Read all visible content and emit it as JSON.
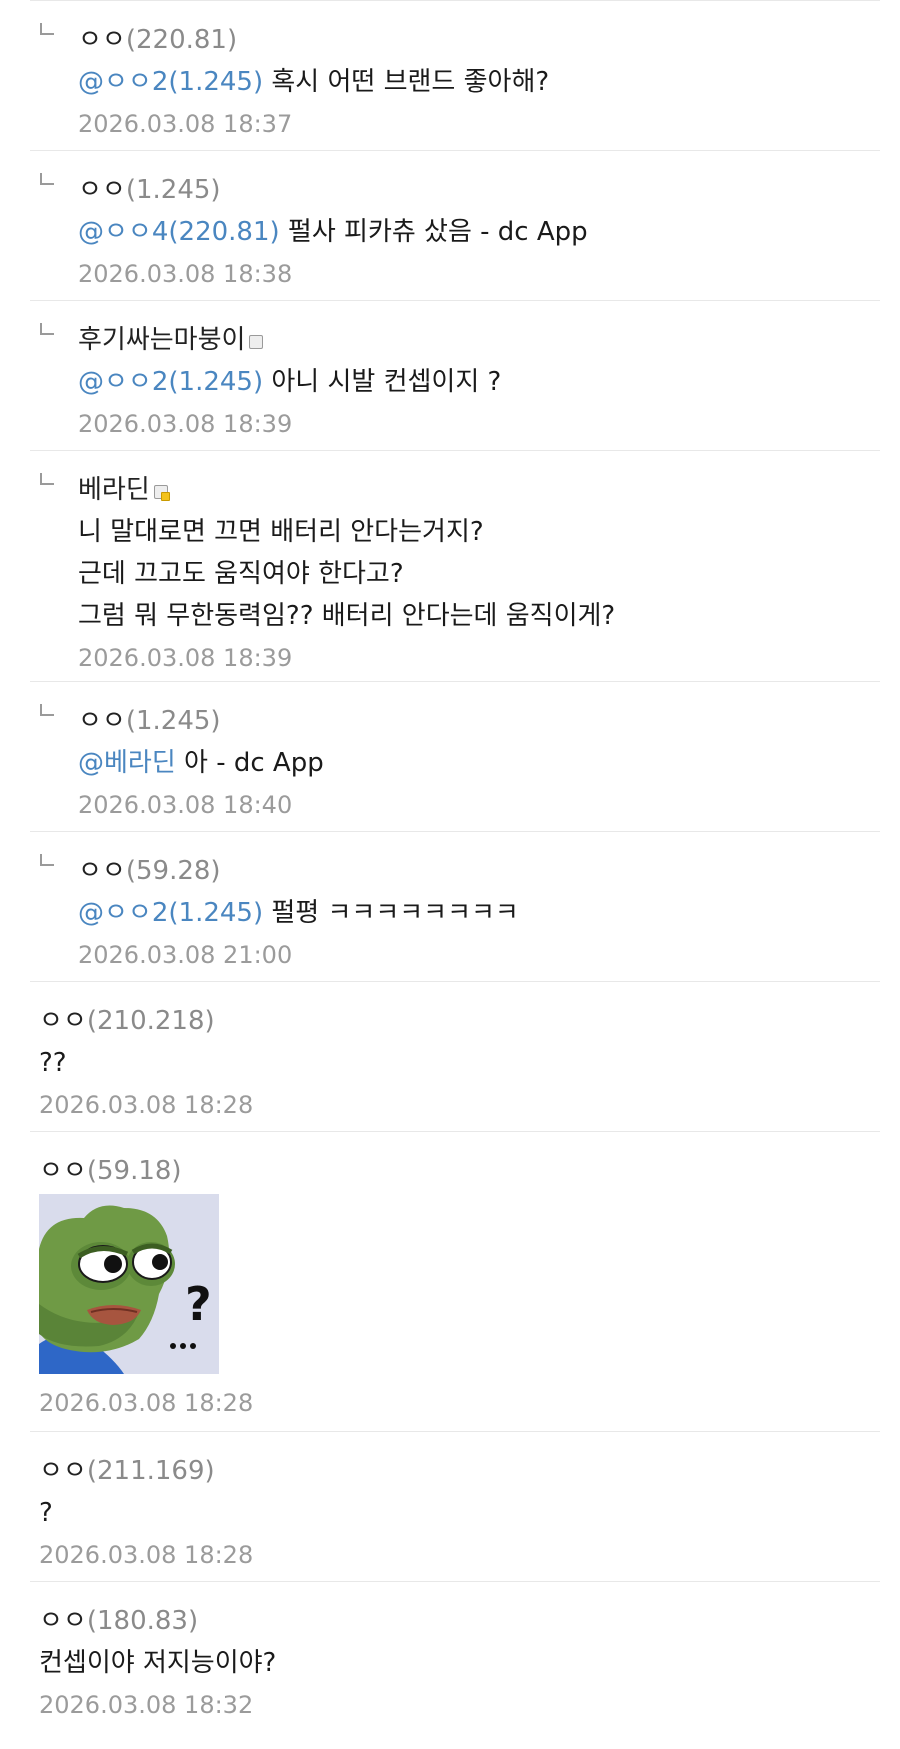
{
  "comments": [
    {
      "reply": true,
      "nick": "ㅇㅇ",
      "ip": "(220.81)",
      "mention": "@ㅇㅇ2(1.245)",
      "text": " 혹시 어떤 브랜드 좋아해?",
      "date": "2026.03.08 18:37"
    },
    {
      "reply": true,
      "nick": "ㅇㅇ",
      "ip": "(1.245)",
      "mention": "@ㅇㅇ4(220.81)",
      "text": " 펄사 피카츄 샀음 - dc App",
      "date": "2026.03.08 18:38"
    },
    {
      "reply": true,
      "nick": "후기싸는마붕이",
      "icon": "gallog-icon",
      "mention": "@ㅇㅇ2(1.245)",
      "text": " 아니 시발 컨셉이지 ?",
      "date": "2026.03.08 18:39"
    },
    {
      "reply": true,
      "nick": "베라딘",
      "icon": "fixed-gallog-icon",
      "lines": [
        "니 말대로면 끄면 배터리 안다는거지?",
        "근데 끄고도 움직여야 한다고?",
        "그럼 뭐 무한동력임?? 배터리 안다는데 움직이게?"
      ],
      "date": "2026.03.08 18:39"
    },
    {
      "reply": true,
      "nick": "ㅇㅇ",
      "ip": "(1.245)",
      "mention": "@베라딘",
      "text": " 아 - dc App",
      "date": "2026.03.08 18:40"
    },
    {
      "reply": true,
      "nick": "ㅇㅇ",
      "ip": "(59.28)",
      "mention": "@ㅇㅇ2(1.245)",
      "text": " 펄평 ㅋㅋㅋㅋㅋㅋㅋㅋ",
      "date": "2026.03.08 21:00"
    },
    {
      "reply": false,
      "nick": "ㅇㅇ",
      "ip": "(210.218)",
      "text": "??",
      "date": "2026.03.08 18:28"
    },
    {
      "reply": false,
      "nick": "ㅇㅇ",
      "ip": "(59.18)",
      "image": "pepe-question-dccon",
      "date": "2026.03.08 18:28"
    },
    {
      "reply": false,
      "nick": "ㅇㅇ",
      "ip": "(211.169)",
      "text": "?",
      "date": "2026.03.08 18:28"
    },
    {
      "reply": false,
      "nick": "ㅇㅇ",
      "ip": "(180.83)",
      "text": "컨셉이야 저지능이야?",
      "date": "2026.03.08 18:32"
    }
  ],
  "colors": {
    "mention": "#4a86c0",
    "date": "#9b9b9b",
    "ip": "#8a8a8a",
    "divider": "#e8e8e8"
  }
}
